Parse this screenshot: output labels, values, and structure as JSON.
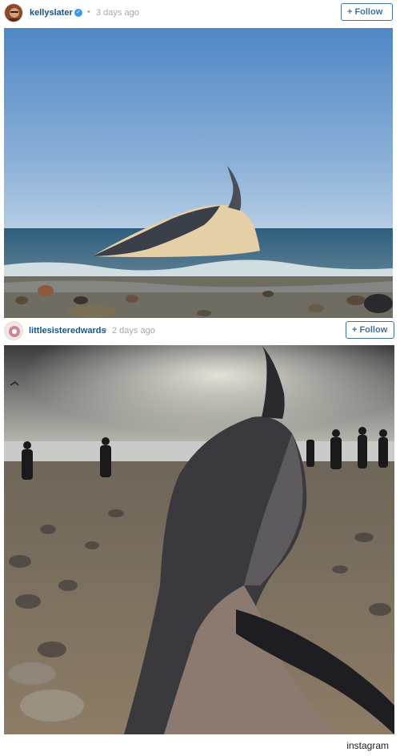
{
  "posts": [
    {
      "username": "kellyslater",
      "verified": true,
      "separator": "•",
      "time": "3 days ago",
      "follow_label": "Follow",
      "photo_subject": "humpback whale carcass on shore at sunset beach"
    },
    {
      "username": "littlesisteredwards",
      "verified": false,
      "separator": "•",
      "time": "2 days ago",
      "follow_label": "Follow",
      "photo_subject": "beached whale on rocky sand with onlookers"
    }
  ],
  "source": "instagram",
  "colors": {
    "username": "#125688",
    "follow": "#3f729b",
    "verified": "#3897f0",
    "muted": "#a5a7aa"
  },
  "icons": {
    "verified": "verified-badge-icon",
    "follow_plus": "plus-icon"
  }
}
